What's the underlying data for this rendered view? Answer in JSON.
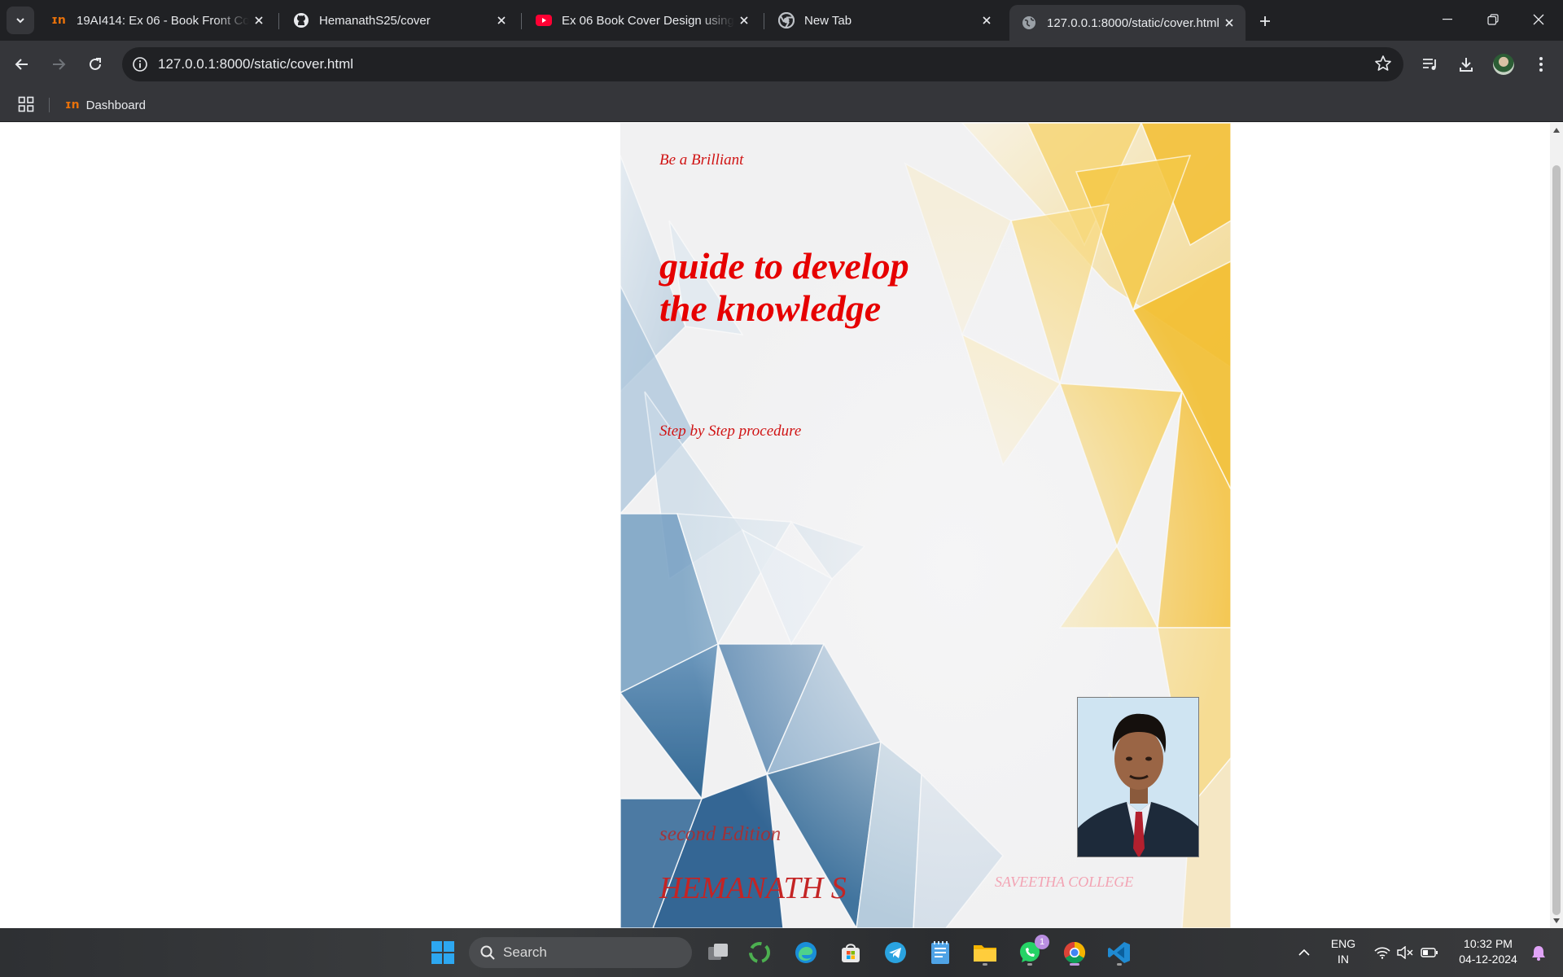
{
  "browser": {
    "tabs": [
      {
        "title": "19AI414: Ex 06 - Book Front Co",
        "icon": "moodle-icon",
        "active": false
      },
      {
        "title": "HemanathS25/cover",
        "icon": "github-icon",
        "active": false
      },
      {
        "title": "Ex 06 Book Cover Design using",
        "icon": "youtube-icon",
        "active": false
      },
      {
        "title": "New Tab",
        "icon": "chrome-icon",
        "active": false
      },
      {
        "title": "127.0.0.1:8000/static/cover.html",
        "icon": "globe-icon",
        "active": true
      }
    ],
    "url": "127.0.0.1:8000/static/cover.html",
    "bookmarks": [
      {
        "label": "Dashboard",
        "icon": "moodle-icon"
      }
    ]
  },
  "cover": {
    "tagline": "Be a Brilliant",
    "title_line1": "guide to develop",
    "title_line2": "the knowledge",
    "subtitle": "Step by Step procedure",
    "edition": "second Edition",
    "author": "HEMANATH S",
    "college": "SAVEETHA COLLEGE",
    "colors": {
      "title": "#e60000",
      "blue": "#2d6a9a",
      "yellow": "#f5c542"
    }
  },
  "taskbar": {
    "search_label": "Search",
    "whatsapp_badge": "1",
    "language_line1": "ENG",
    "language_line2": "IN",
    "time": "10:32 PM",
    "date": "04-12-2024"
  }
}
